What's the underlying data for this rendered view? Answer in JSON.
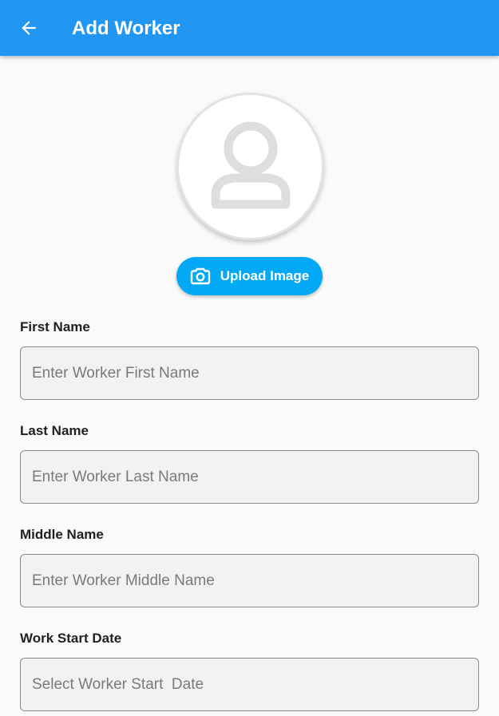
{
  "app_bar": {
    "title": "Add Worker",
    "back_icon": "arrow-left-icon",
    "color": "#2196f3"
  },
  "avatar": {
    "icon": "person-placeholder-icon"
  },
  "upload": {
    "label": "Upload Image",
    "icon": "camera-icon",
    "color": "#03a9f4"
  },
  "fields": [
    {
      "label": "First Name",
      "placeholder": "Enter Worker First Name",
      "value": ""
    },
    {
      "label": "Last Name",
      "placeholder": "Enter Worker Last Name",
      "value": ""
    },
    {
      "label": "Middle Name",
      "placeholder": "Enter Worker Middle Name",
      "value": ""
    },
    {
      "label": "Work Start Date",
      "placeholder": "Select Worker Start  Date",
      "value": ""
    }
  ]
}
